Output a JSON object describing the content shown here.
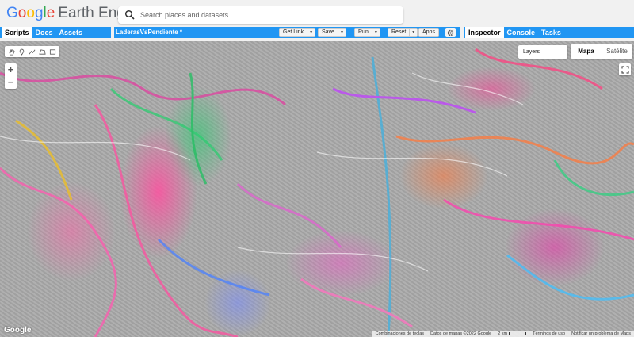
{
  "header": {
    "logo_google": [
      "G",
      "o",
      "o",
      "g",
      "l",
      "e"
    ],
    "logo_product": "Earth Engine",
    "search_placeholder": "Search places and datasets..."
  },
  "left_panel": {
    "tabs": [
      {
        "label": "Scripts",
        "active": true
      },
      {
        "label": "Docs",
        "active": false
      },
      {
        "label": "Assets",
        "active": false
      }
    ]
  },
  "editor": {
    "title": "LaderasVsPendiente *",
    "buttons": {
      "get_link": "Get Link",
      "save": "Save",
      "run": "Run",
      "reset": "Reset",
      "apps": "Apps"
    }
  },
  "right_panel": {
    "tabs": [
      {
        "label": "Inspector",
        "active": true
      },
      {
        "label": "Console",
        "active": false
      },
      {
        "label": "Tasks",
        "active": false
      }
    ]
  },
  "map": {
    "zoom_in": "+",
    "zoom_out": "−",
    "layers_label": "Layers",
    "map_types": [
      {
        "label": "Mapa",
        "selected": true
      },
      {
        "label": "Satélite",
        "selected": false
      }
    ],
    "google_logo": "Google",
    "attribution": {
      "shortcuts": "Combinaciones de teclas",
      "map_data": "Datos de mapas ©2022 Google",
      "scale": "2 km",
      "terms": "Términos de uso",
      "report": "Notificar un problema de Maps"
    }
  },
  "colors": {
    "toolbar_blue": "#2196f3",
    "header_bg": "#f1f1f1"
  },
  "icons": [
    "search-icon",
    "hand-icon",
    "marker-icon",
    "line-icon",
    "polygon-icon",
    "rectangle-icon",
    "gear-icon",
    "fullscreen-icon"
  ]
}
